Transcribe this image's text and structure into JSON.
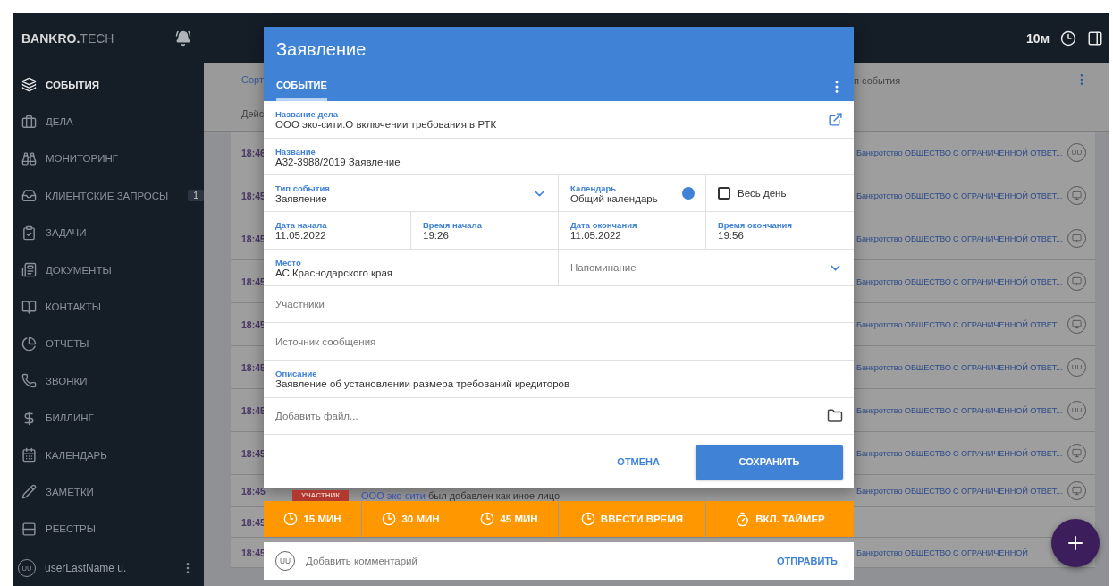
{
  "topbar": {
    "logo_main": "BANKRO.",
    "logo_accent": "TECH",
    "timer": "10м"
  },
  "sidebar": {
    "items": [
      {
        "label": "СОБЫТИЯ",
        "selected": true
      },
      {
        "label": "ДЕЛА",
        "selected": false
      },
      {
        "label": "МОНИТОРИНГ",
        "selected": false
      },
      {
        "label": "КЛИЕНТСКИЕ ЗАПРОСЫ",
        "selected": false,
        "badge": "1"
      },
      {
        "label": "ЗАДАЧИ",
        "selected": false
      },
      {
        "label": "ДОКУМЕНТЫ",
        "selected": false
      },
      {
        "label": "КОНТАКТЫ",
        "selected": false
      },
      {
        "label": "ОТЧЕТЫ",
        "selected": false
      },
      {
        "label": "ЗВОНКИ",
        "selected": false
      },
      {
        "label": "БИЛЛИНГ",
        "selected": false
      },
      {
        "label": "КАЛЕНДАРЬ",
        "selected": false
      },
      {
        "label": "ЗАМЕТКИ",
        "selected": false
      },
      {
        "label": "РЕЕСТРЫ",
        "selected": false
      }
    ],
    "user": {
      "avatar": "UU",
      "name": "userLastName u."
    }
  },
  "list": {
    "header": {
      "sort": "Сорт",
      "actions": "Дейс",
      "type": "п события"
    },
    "rows": [
      {
        "time": "18:46",
        "case": "Банкротство ОБЩЕСТВО С ОГРАНИЧЕННОЙ ОТВЕТ...",
        "avatar": {
          "kind": "initials",
          "text": "UU"
        }
      },
      {
        "time": "18:45",
        "case": "Банкротство ОБЩЕСТВО С ОГРАНИЧЕННОЙ ОТВЕТ...",
        "avatar": {
          "kind": "device"
        }
      },
      {
        "time": "18:45",
        "case": "Банкротство ОБЩЕСТВО С ОГРАНИЧЕННОЙ ОТВЕТ...",
        "avatar": {
          "kind": "device"
        }
      },
      {
        "time": "18:45",
        "case": "Банкротство ОБЩЕСТВО С ОГРАНИЧЕННОЙ ОТВЕТ...",
        "avatar": {
          "kind": "device"
        }
      },
      {
        "time": "18:45",
        "case": "Банкротство ОБЩЕСТВО С ОГРАНИЧЕННОЙ ОТВЕТ...",
        "avatar": {
          "kind": "device"
        }
      },
      {
        "time": "18:45",
        "case": "Банкротство ОБЩЕСТВО С ОГРАНИЧЕННОЙ ОТВЕТ...",
        "avatar": {
          "kind": "initials",
          "text": "UU"
        }
      },
      {
        "time": "18:45",
        "case": "Банкротство ОБЩЕСТВО С ОГРАНИЧЕННОЙ ОТВЕТ...",
        "avatar": {
          "kind": "initials",
          "text": "UU"
        }
      },
      {
        "time": "18:45",
        "case": "Банкротство ОБЩЕСТВО С ОГРАНИЧЕННОЙ ОТВЕТ...",
        "avatar": {
          "kind": "device"
        }
      },
      {
        "time": "18:45",
        "case": "Банкротство ОБЩЕСТВО С ОГРАНИЧЕННОЙ ОТВЕТ...",
        "avatar": {
          "kind": "device"
        }
      },
      {
        "time": "18:45"
      },
      {
        "time": "18:45",
        "case": "Банкротство ОБЩЕСТВО С ОГРАНИЧЕННОЙ"
      }
    ]
  },
  "dialog": {
    "title": "Заявление",
    "tabs": [
      {
        "label": "СОБЫТИЕ",
        "selected": true
      }
    ],
    "case_name": {
      "label": "Название дела",
      "value": "ООО эко-сити.О включении требования в РТК"
    },
    "name": {
      "label": "Название",
      "value": "А32-3988/2019 Заявление"
    },
    "event_type": {
      "label": "Тип события",
      "value": "Заявление"
    },
    "calendar": {
      "label": "Календарь",
      "value": "Общий календарь",
      "color": "#3f82d6"
    },
    "all_day": {
      "label": "Весь день",
      "checked": false
    },
    "start_date": {
      "label": "Дата начала",
      "value": "11.05.2022"
    },
    "start_time": {
      "label": "Время начала",
      "value": "19:26"
    },
    "end_date": {
      "label": "Дата окончания",
      "value": "11.05.2022"
    },
    "end_time": {
      "label": "Время окончания",
      "value": "19:56"
    },
    "place": {
      "label": "Место",
      "value": "АС Краснодарского края"
    },
    "reminder": {
      "placeholder": "Напоминание"
    },
    "participants": {
      "placeholder": "Участники"
    },
    "source": {
      "placeholder": "Источник сообщения"
    },
    "description": {
      "label": "Описание",
      "value": "Заявление об установлении размера требований кредиторов"
    },
    "attachment": {
      "placeholder": "Добавить файл..."
    },
    "cancel": "ОТМЕНА",
    "save": "СОХРАНИТЬ"
  },
  "activity": {
    "tag": "УЧАСТНИК",
    "link": "ООО эко-сити",
    "text": " был добавлен как иное лицо"
  },
  "time_buttons": [
    {
      "label": "15 МИН",
      "kind": "preset"
    },
    {
      "label": "30 МИН",
      "kind": "preset"
    },
    {
      "label": "45 МИН",
      "kind": "preset"
    },
    {
      "label": "ВВЕСТИ ВРЕМЯ",
      "kind": "preset"
    },
    {
      "label": "ВКЛ. ТАЙМЕР",
      "kind": "timer"
    }
  ],
  "comment": {
    "avatar": "UU",
    "placeholder": "Добавить комментарий",
    "send": "ОТПРАВИТЬ"
  }
}
